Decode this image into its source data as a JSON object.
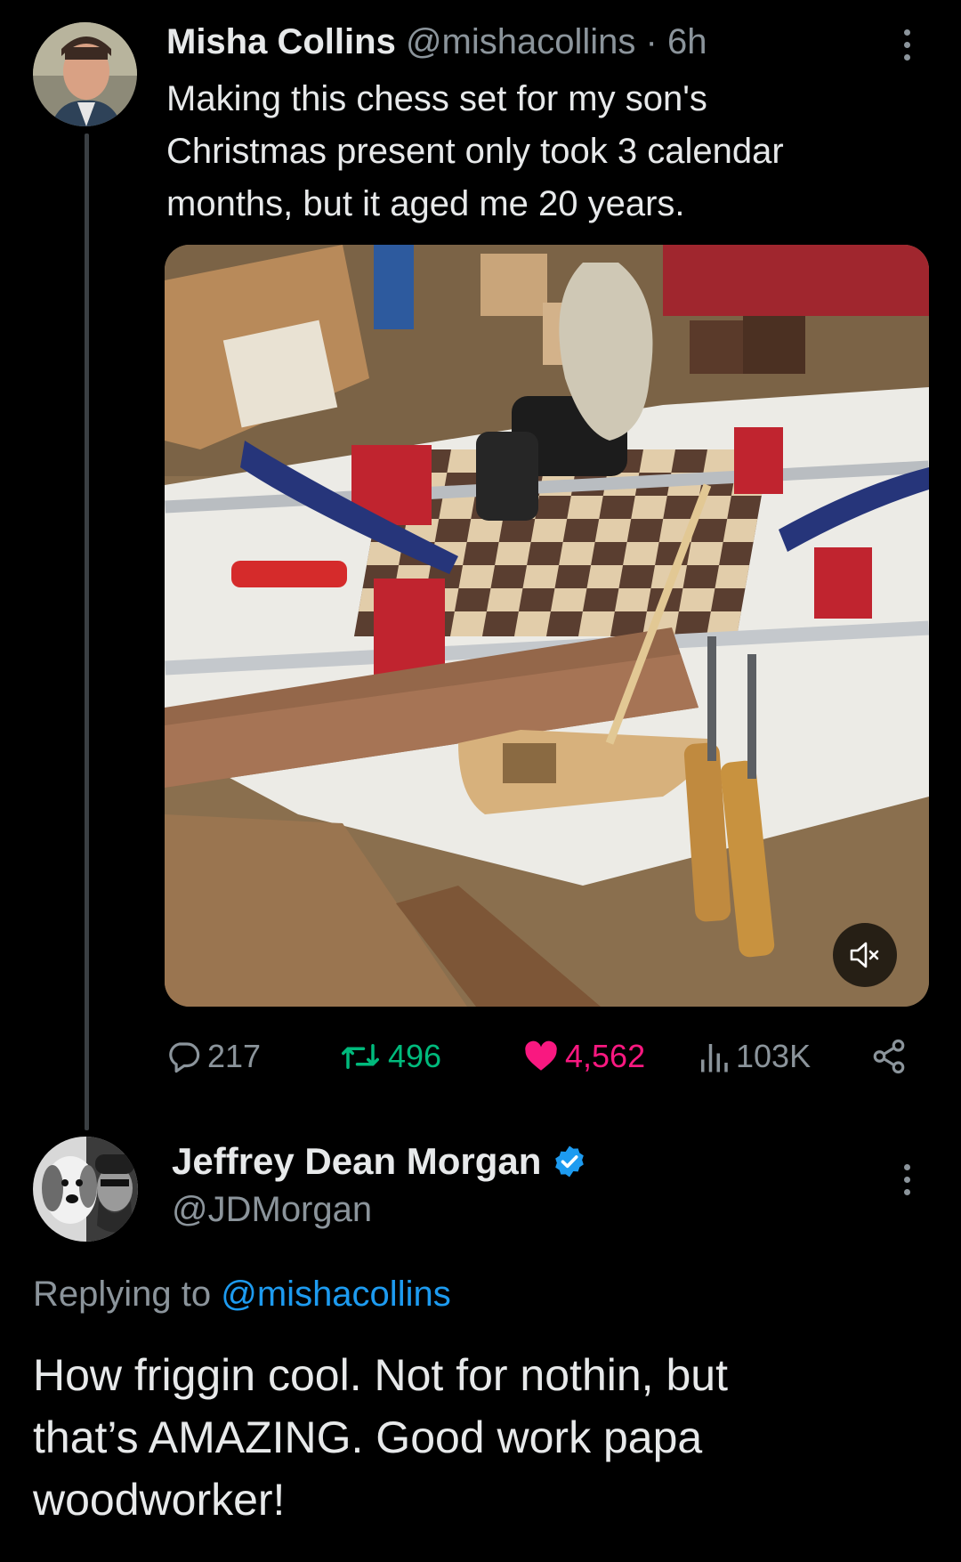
{
  "tweet": {
    "author_name": "Misha Collins",
    "handle": "@mishacollins",
    "separator": "·",
    "time": "6h",
    "text_lines": [
      "Making this chess set for my son's",
      "Christmas present only took 3 calendar",
      "months, but it aged me 20 years."
    ],
    "media": {
      "type": "video",
      "muted": true,
      "icon": "speaker-muted-icon"
    },
    "stats": {
      "replies": "217",
      "retweets": "496",
      "likes": "4,562",
      "views": "103K"
    },
    "colors": {
      "retweet": "#00ba7c",
      "like": "#f91880"
    }
  },
  "reply": {
    "author_name": "Jeffrey Dean Morgan",
    "verified": true,
    "handle": "@JDMorgan",
    "replying_prefix": "Replying to",
    "replying_to": "@mishacollins",
    "text_lines": [
      "How friggin cool. Not for nothin, but",
      "that’s AMAZING. Good work papa",
      "woodworker!"
    ]
  },
  "colors": {
    "background": "#000000",
    "text": "#e7e9ea",
    "muted": "#8b949b",
    "link": "#1d9bf0"
  }
}
